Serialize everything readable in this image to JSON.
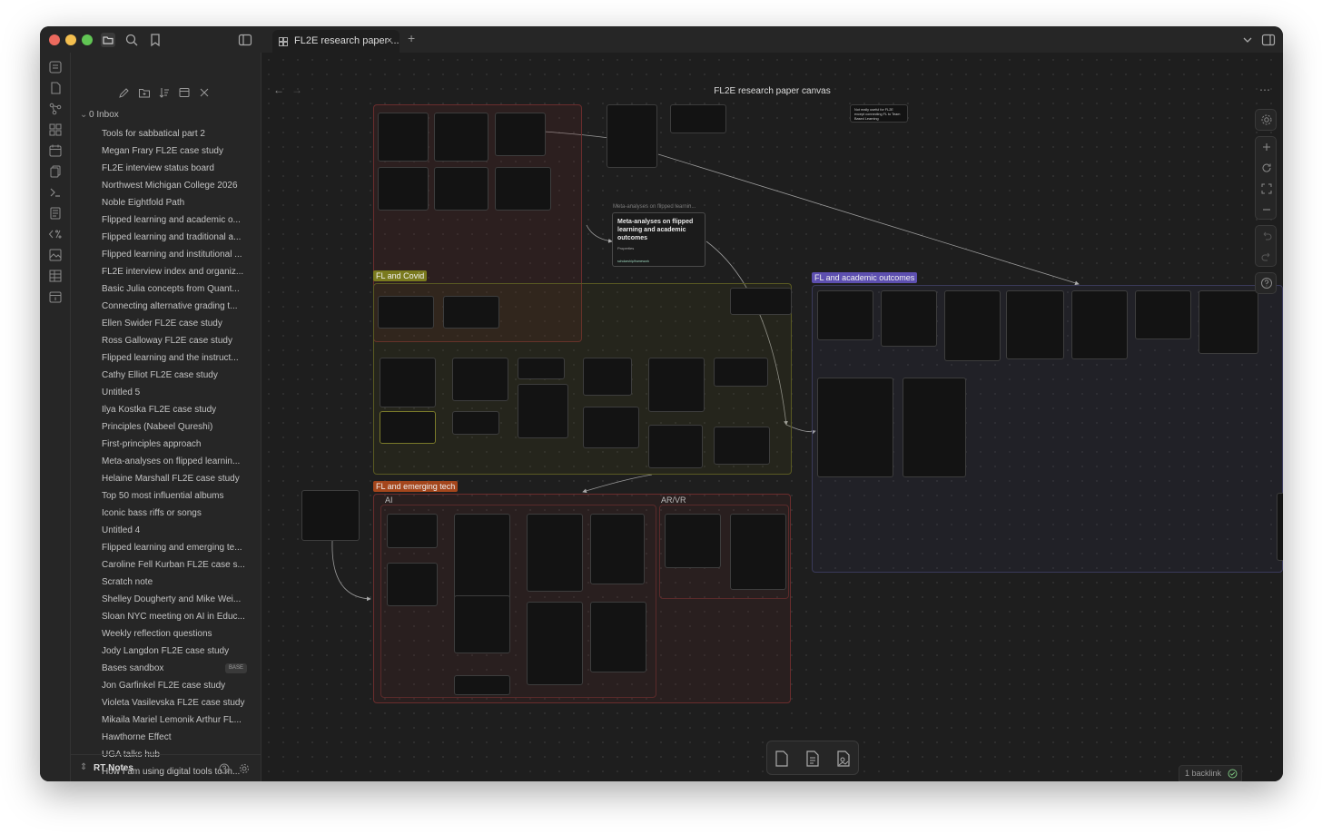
{
  "window": {
    "title": "FL2E research paper canvas",
    "tab_label": "FL2E research paper ...",
    "tab_close": "×",
    "new_tab": "+"
  },
  "colors": {
    "red": "#ec6a5e",
    "yellow": "#f4bf4f",
    "green": "#61c554",
    "accent": "#8f7fe0"
  },
  "sidebar": {
    "folder": "0 Inbox",
    "files": [
      "Tools for sabbatical part 2",
      "Megan Frary FL2E case study",
      "FL2E interview status board",
      "Northwest Michigan College 2026",
      "Noble Eightfold Path",
      "Flipped learning and academic o...",
      "Flipped learning and traditional a...",
      "Flipped learning and institutional ...",
      "FL2E interview index and organiz...",
      "Basic Julia concepts from Quant...",
      "Connecting alternative grading t...",
      "Ellen Swider FL2E case study",
      "Ross Galloway FL2E case study",
      "Flipped learning and the instruct...",
      "Cathy Elliot FL2E case study",
      "Untitled 5",
      "Ilya Kostka FL2E case study",
      "Principles (Nabeel Qureshi)",
      "First-principles approach",
      "Meta-analyses on flipped learnin...",
      "Helaine Marshall FL2E case study",
      "Top 50 most influential albums",
      "Iconic bass riffs or songs",
      "Untitled 4",
      "Flipped learning and emerging te...",
      "Caroline Fell Kurban FL2E case s...",
      "Scratch note",
      "Shelley Dougherty and Mike Wei...",
      "Sloan NYC meeting on AI in Educ...",
      "Weekly reflection questions",
      "Jody Langdon FL2E case study",
      "Bases sandbox",
      "Jon Garfinkel FL2E case study",
      "Violeta Vasilevska FL2E case study",
      "Mikaila Mariel Lemonik Arthur FL...",
      "Hawthorne Effect",
      "UGA talks hub",
      "How I am using digital tools to m..."
    ],
    "base_badge": "BASE",
    "vault_name": "RT Notes"
  },
  "canvas": {
    "groups": {
      "covid": "FL and Covid",
      "academic": "FL and academic outcomes",
      "emerging": "FL and emerging tech",
      "ai": "AI",
      "arvr": "AR/VR"
    },
    "note_card": {
      "header": "Meta-analyses on flipped learnin...",
      "title": "Meta-analyses on flipped learning and academic outcomes",
      "props": "Properties",
      "tag": "scholarship/framework"
    },
    "small_note": "Not really useful for FL2E except connecting FL to Team Based Learning"
  },
  "footer": {
    "backlinks": "1 backlink"
  }
}
